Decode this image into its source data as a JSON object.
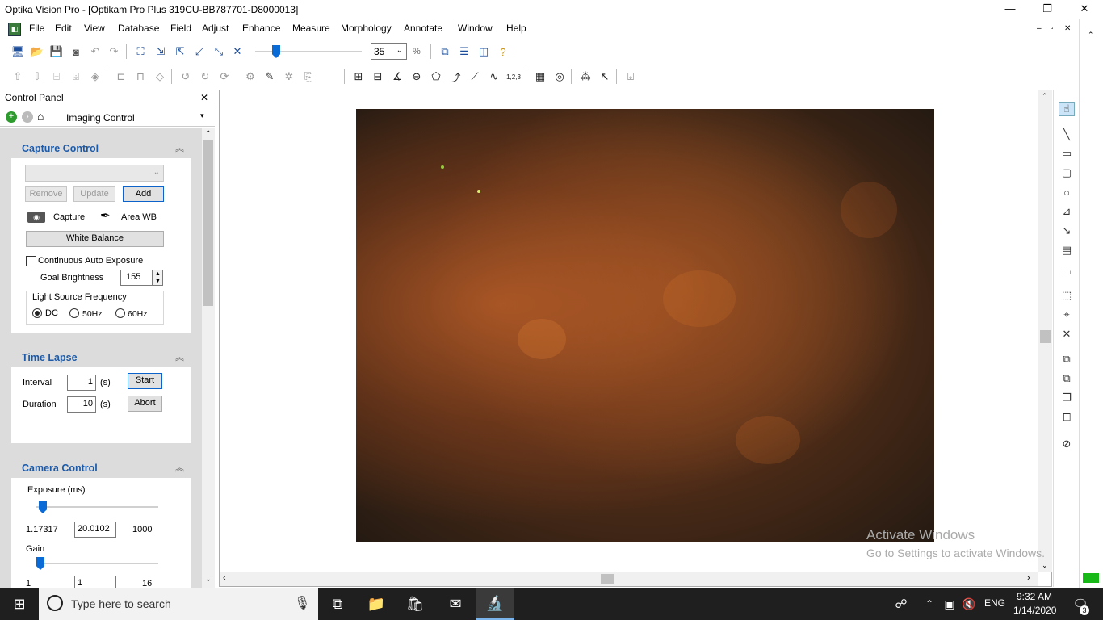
{
  "window": {
    "title": "Optika Vision Pro - [Optikam Pro Plus 319CU-BB787701-D8000013]",
    "minimize": "—",
    "restore": "❐",
    "close": "✕"
  },
  "menu": [
    "File",
    "Edit",
    "View",
    "Database",
    "Field",
    "Adjust",
    "Enhance",
    "Measure",
    "Morphology",
    "Annotate",
    "Window",
    "Help"
  ],
  "mdi_controls": [
    "–",
    "▫",
    "✕"
  ],
  "toolbar": {
    "zoom_value": "35",
    "zoom_unit": "%",
    "zoom_level": 0.35
  },
  "control_panel": {
    "title": "Control Panel",
    "close": "✕",
    "combo_label": "Imaging Control",
    "capture_control": {
      "title": "Capture Control",
      "remove": "Remove",
      "update": "Update",
      "add": "Add",
      "capture": "Capture",
      "area_wb": "Area WB",
      "white_balance": "White Balance",
      "continuous_auto_exposure": "Continuous Auto Exposure",
      "goal_brightness_label": "Goal Brightness",
      "goal_brightness_value": "155",
      "light_source_label": "Light Source Frequency",
      "options": [
        "DC",
        "50Hz",
        "60Hz"
      ],
      "selected": "DC"
    },
    "time_lapse": {
      "title": "Time Lapse",
      "interval_label": "Interval",
      "interval_value": "1",
      "interval_unit": "(s)",
      "duration_label": "Duration",
      "duration_value": "10",
      "duration_unit": "(s)",
      "start": "Start",
      "abort": "Abort"
    },
    "camera_control": {
      "title": "Camera Control",
      "exposure_label": "Exposure (ms)",
      "exposure_min": "1.17317",
      "exposure_value": "20.0102",
      "exposure_max": "1000",
      "gain_label": "Gain",
      "gain_min": "1",
      "gain_value": "1",
      "gain_max": "16"
    }
  },
  "watermark": {
    "line1": "Activate Windows",
    "line2": "Go to Settings to activate Windows."
  },
  "taskbar": {
    "search_placeholder": "Type here to search",
    "language": "ENG",
    "time": "9:32 AM",
    "date": "1/14/2020",
    "notifications": "3"
  }
}
